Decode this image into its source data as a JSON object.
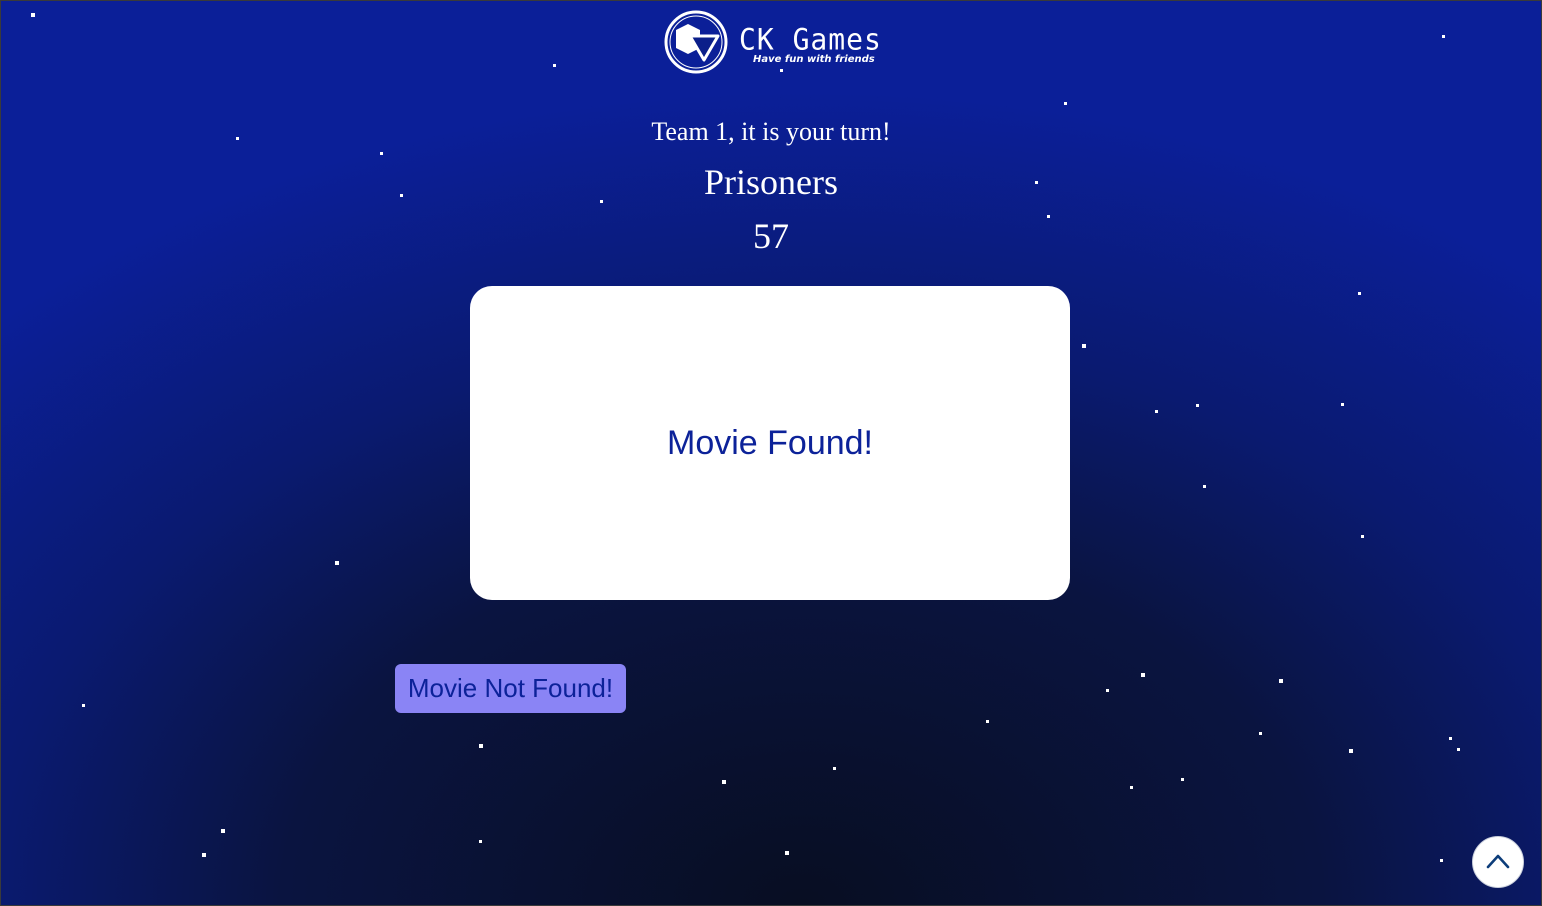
{
  "logo": {
    "title": "CK Games",
    "tagline": "Have fun with friends"
  },
  "game": {
    "turn_text": "Team 1, it is your turn!",
    "category": "Prisoners",
    "timer": "57",
    "card_text": "Movie Found!",
    "not_found_label": "Movie Not Found!"
  },
  "icons": {
    "logo": "ck-games-logo-icon",
    "scroll_top": "chevron-up-icon"
  },
  "colors": {
    "background": "#0b1f98",
    "card": "#ffffff",
    "card_text": "#0c2299",
    "secondary_button": "#8a84f5"
  }
}
